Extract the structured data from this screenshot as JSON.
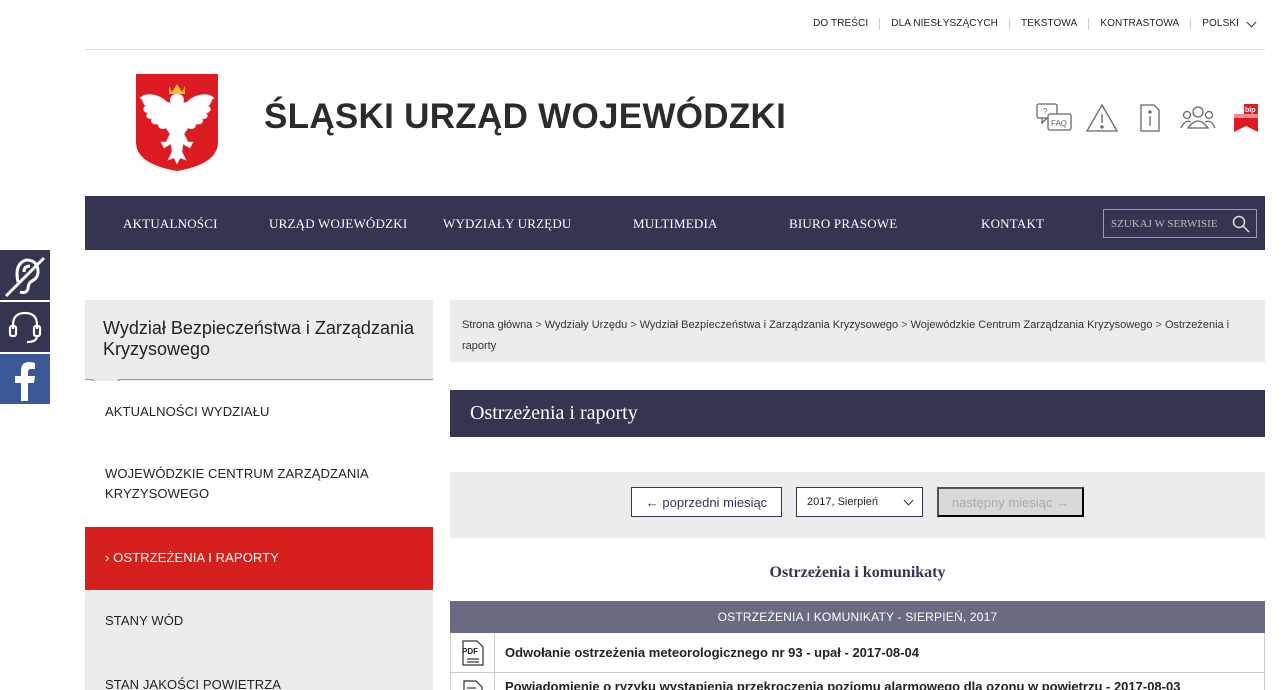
{
  "topbar": {
    "links": [
      "DO TREŚCI",
      "DLA NIESŁYSZĄCYCH",
      "TEKSTOWA",
      "KONTRASTOWA"
    ],
    "language": "POLSKI"
  },
  "header": {
    "title": "ŚLĄSKI URZĄD WOJEWÓDZKI",
    "icons": [
      "faq-icon",
      "warning-icon",
      "info-icon",
      "people-icon",
      "bip-icon"
    ],
    "faq_label": "FAQ",
    "bip_label": "bip"
  },
  "nav": {
    "items": [
      "AKTUALNOŚCI",
      "URZĄD WOJEWÓDZKI",
      "WYDZIAŁY URZĘDU",
      "MULTIMEDIA",
      "BIURO PRASOWE",
      "KONTAKT"
    ],
    "search_placeholder": "SZUKAJ W SERWISIE"
  },
  "sidebar": {
    "heading": "Wydział Bezpieczeństwa i Zarządzania Kryzysowego",
    "items": [
      {
        "label": "AKTUALNOŚCI WYDZIAŁU"
      },
      {
        "label": "WOJEWÓDZKIE CENTRUM ZARZĄDZANIA KRYZYSOWEGO"
      },
      {
        "label": "› OSTRZEŻENIA I RAPORTY"
      },
      {
        "label": "STANY WÓD"
      },
      {
        "label": "STAN JAKOŚCI POWIETRZA"
      }
    ]
  },
  "breadcrumb": {
    "items": [
      "Strona główna",
      "Wydziały Urzędu",
      "Wydział Bezpieczeństwa i Zarządzania Kryzysowego",
      "Wojewódzkie Centrum Zarządzania Kryzysowego",
      "Ostrzeżenia i raporty"
    ]
  },
  "page": {
    "title": "Ostrzeżenia i raporty",
    "prev_label": "← poprzedni miesiąc",
    "month_value": "2017, Sierpień",
    "next_label": "następny miesiąc →",
    "section_title": "Ostrzeżenia i komunikaty",
    "table_header": "OSTRZEŻENIA I KOMUNIKATY - SIERPIEŃ, 2017",
    "rows": [
      {
        "icon": "pdf-icon",
        "text": "Odwołanie ostrzeżenia meteorologicznego nr 93 - upał - 2017-08-04"
      },
      {
        "icon": "document-icon",
        "text": "Powiadomienie o ryzyku wystąpienia przekroczenia poziomu alarmowego dla ozonu w powietrzu - 2017-08-03"
      }
    ]
  },
  "colors": {
    "navy": "#353552",
    "red": "#d6201e",
    "gray": "#ececec",
    "table_head": "#6a6a82",
    "facebook": "#3b5998"
  }
}
